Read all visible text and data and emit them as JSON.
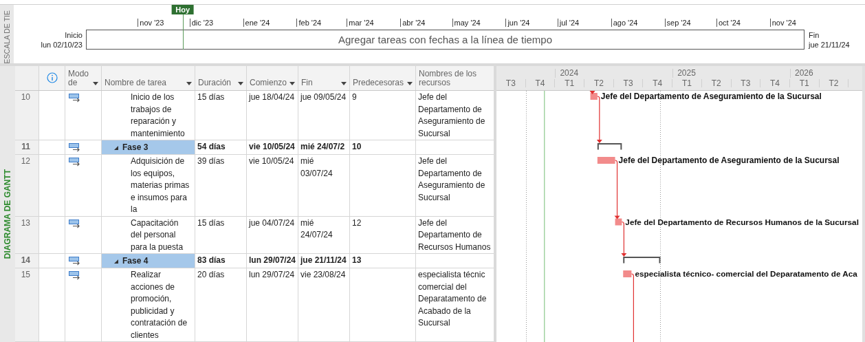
{
  "side_tabs": {
    "timeline": "ESCALA DE TIE",
    "gantt": "DIAGRAMA DE GANTT"
  },
  "timeline": {
    "today_label": "Hoy",
    "start_label": "Inicio",
    "start_date": "lun 02/10/23",
    "end_label": "Fin",
    "end_date": "jue 21/11/24",
    "placeholder": "Agregar tareas con fechas a la línea de tiempo",
    "months": [
      "nov '23",
      "dic '23",
      "ene '24",
      "feb '24",
      "mar '24",
      "abr '24",
      "may '24",
      "jun '24",
      "jul '24",
      "ago '24",
      "sep '24",
      "oct '24",
      "nov '24"
    ]
  },
  "table": {
    "columns": [
      {
        "kind": "info",
        "menu": false
      },
      {
        "kind": "text",
        "label": "Modo de",
        "menu": true
      },
      {
        "kind": "text",
        "label": "Nombre de tarea",
        "menu": true
      },
      {
        "kind": "text",
        "label": "Duración",
        "menu": true
      },
      {
        "kind": "text",
        "label": "Comienzo",
        "menu": true
      },
      {
        "kind": "text",
        "label": "Fin",
        "menu": true
      },
      {
        "kind": "text",
        "label": "Predecesoras",
        "menu": true
      },
      {
        "kind": "text",
        "label": "Nombres de los recursos",
        "menu": false
      }
    ],
    "rows": [
      {
        "id": "10",
        "kind": "task",
        "name": "Inicio de los trabajos de reparación y mantenimiento",
        "duration": "15 días",
        "start": "jue 18/04/24",
        "finish": "jue 09/05/24",
        "predecessors": "9",
        "resources": "Jefe del Departamento de Aseguramiento de Sucursal",
        "bar_label": "Jefe del Departamento de Aseguramiento de la Sucursal",
        "link_below": false
      },
      {
        "id": "11",
        "kind": "summary",
        "name": "Fase 3",
        "duration": "54 días",
        "start": "vie 10/05/24",
        "finish": "mié 24/07/2",
        "predecessors": "10",
        "link_below": false
      },
      {
        "id": "12",
        "kind": "task",
        "name": "Adquisición de los equipos, materias primas e insumos para la",
        "duration": "39 días",
        "start": "vie 10/05/24",
        "finish": "mié 03/07/24",
        "resources": "Jefe del Departamento de Aseguramiento de Sucursal",
        "bar_label": "Jefe del Departamento de Aseguramiento de la Sucursal",
        "link_below": false
      },
      {
        "id": "13",
        "kind": "task",
        "name": "Capacitación del personal para la puesta",
        "duration": "15 días",
        "start": "jue 04/07/24",
        "finish": "mié 24/07/24",
        "predecessors": "12",
        "resources": "Jefe del Departamento de Recursos Humanos",
        "bar_label": "Jefe del Departamento de Recursos Humanos de la Sucursal",
        "link_below": false
      },
      {
        "id": "14",
        "kind": "summary",
        "name": "Fase 4",
        "duration": "83 días",
        "start": "lun 29/07/24",
        "finish": "jue 21/11/24",
        "predecessors": "13",
        "link_below": false
      },
      {
        "id": "15",
        "kind": "task",
        "name": "Realizar acciones de promoción, publicidad y contratación de clientes",
        "duration": "20 días",
        "start": "lun 29/07/24",
        "finish": "vie 23/08/24",
        "resources": "especialista técnic comercial del Deparatamento de Acabado de la Sucursal",
        "bar_label": "especialista técnico- comercial del Deparatamento de Aca",
        "link_below": true
      }
    ]
  },
  "gantt": {
    "years": [
      "2024",
      "2025",
      "2026"
    ],
    "quarters": [
      "T3",
      "T4",
      "T1",
      "T2",
      "T3",
      "T4",
      "T1",
      "T2",
      "T3",
      "T4",
      "T1",
      "T2"
    ]
  }
}
